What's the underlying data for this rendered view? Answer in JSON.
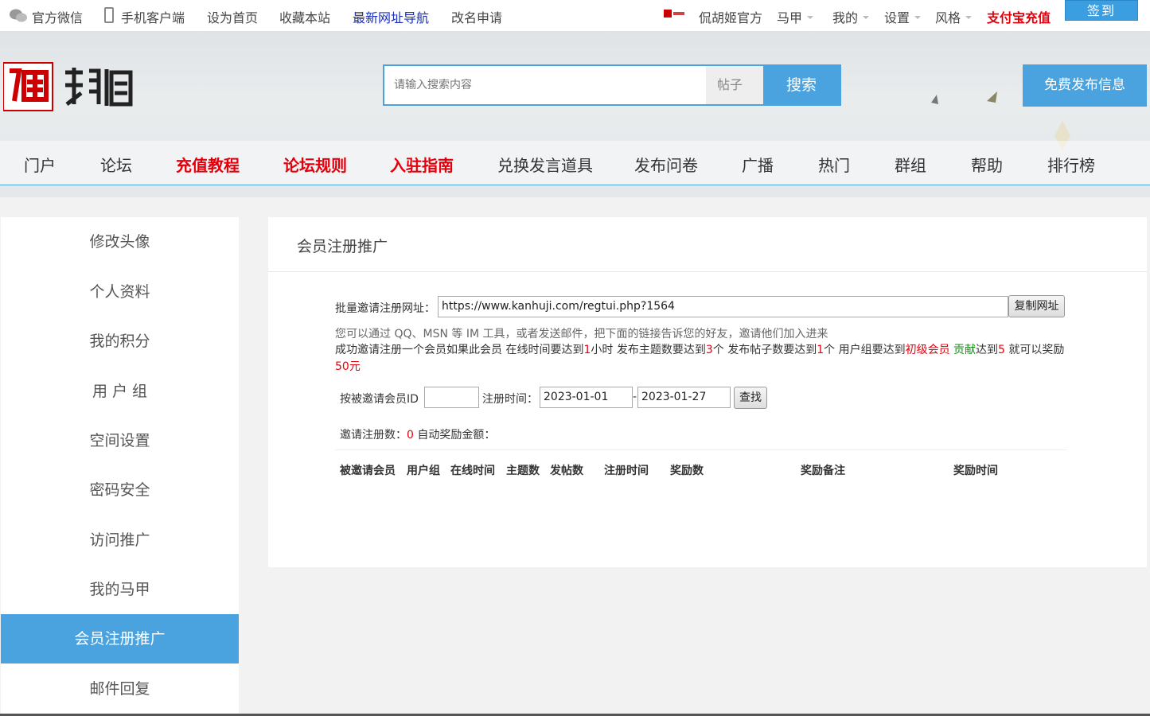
{
  "topbar": {
    "wechat": "官方微信",
    "mobile": "手机客户端",
    "homepage": "设为首页",
    "favorite": "收藏本站",
    "nav_link": "最新网址导航",
    "rename": "改名申请",
    "user": "侃胡姬官方",
    "majia": "马甲",
    "mine": "我的",
    "settings": "设置",
    "style": "风格",
    "alipay": "支付宝充值",
    "checkin": "签到"
  },
  "search": {
    "placeholder": "请输入搜索内容",
    "type": "帖子",
    "button": "搜索"
  },
  "post_button": "免费发布信息",
  "nav": [
    "门户",
    "论坛",
    "充值教程",
    "论坛规则",
    "入驻指南",
    "兑换发言道具",
    "发布问卷",
    "广播",
    "热门",
    "群组",
    "帮助",
    "排行榜"
  ],
  "sidebar": [
    "修改头像",
    "个人资料",
    "我的积分",
    "用 户 组",
    "空间设置",
    "密码安全",
    "访问推广",
    "我的马甲",
    "会员注册推广",
    "邮件回复"
  ],
  "main": {
    "title": "会员注册推广",
    "invite_label": "批量邀请注册网址：",
    "invite_url": "https://www.kanhuji.com/regtui.php?1564",
    "copy_button": "复制网址",
    "hint": "您可以通过 QQ、MSN 等 IM 工具，或者发送邮件，把下面的链接告诉您的好友，邀请他们加入进来",
    "rule": {
      "p1": "成功邀请注册一个会员如果此会员 在线时间要达到",
      "hours": "1",
      "p2": "小时 发布主题数要达到",
      "topics": "3",
      "p3": "个 发布帖子数要达到",
      "posts": "1",
      "p4": "个 用户组要达到",
      "group": "初级会员",
      "p5": " ",
      "contrib": "贡献",
      "p6": "达到",
      "contrib_val": "5",
      "p7": " 就可以奖励",
      "reward": "50元"
    },
    "filter_label": "按被邀请会员ID",
    "filter_id": "",
    "date_label": "注册时间：",
    "date_from": "2023-01-01",
    "date_sep": "-",
    "date_to": "2023-01-27",
    "find_button": "查找",
    "count_label": "邀请注册数：",
    "count": "0",
    "reward_label": "自动奖励金额：",
    "columns": [
      "被邀请会员",
      "用户组",
      "在线时间",
      "主题数",
      "发帖数",
      "注册时间",
      "奖励数",
      "奖励备注",
      "奖励时间"
    ]
  }
}
